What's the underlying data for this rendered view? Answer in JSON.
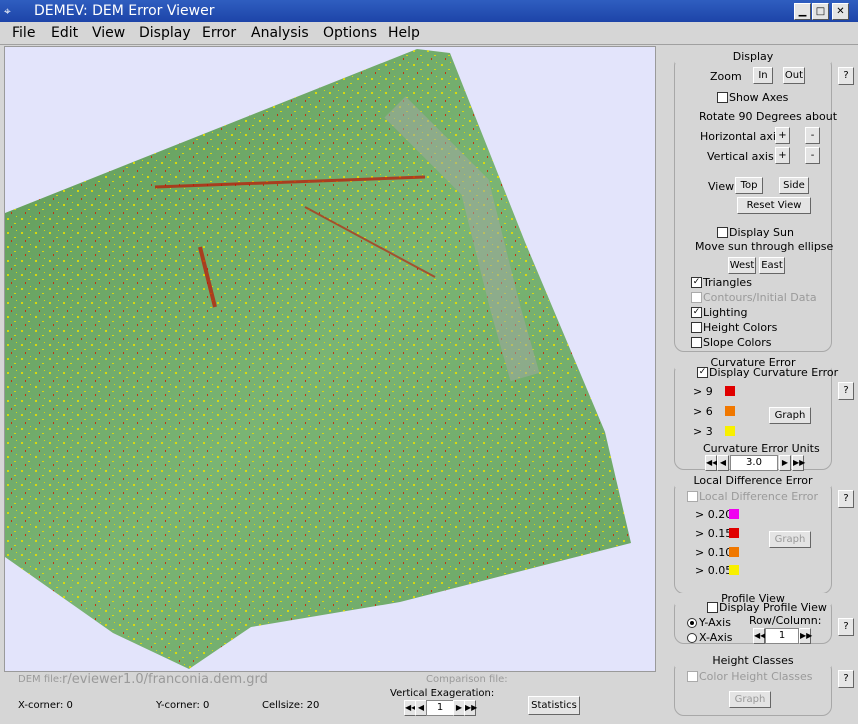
{
  "window": {
    "title": "DEMEV: DEM Error Viewer",
    "icon_label": "⌖"
  },
  "window_buttons": {
    "minimize": "▁",
    "maximize": "□",
    "close": "✕"
  },
  "menu": [
    "File",
    "Edit",
    "View",
    "Display",
    "Error",
    "Analysis",
    "Options",
    "Help"
  ],
  "display": {
    "title": "Display",
    "zoom_label": "Zoom",
    "zoom_in": "In",
    "zoom_out": "Out",
    "show_axes": "Show Axes",
    "rotate_label": "Rotate 90 Degrees about",
    "horizontal_axis": "Horizontal axis",
    "vertical_axis": "Vertical axis",
    "plus": "+",
    "minus": "-",
    "view_label": "View",
    "view_top": "Top",
    "view_side": "Side",
    "reset_view": "Reset View",
    "display_sun": "Display Sun",
    "move_sun": "Move sun through ellipse",
    "west": "West",
    "east": "East",
    "triangles": "Triangles",
    "contours": "Contours/Initial Data",
    "lighting": "Lighting",
    "height_colors": "Height Colors",
    "slope_colors": "Slope Colors",
    "help": "?"
  },
  "curvature": {
    "title": "Curvature Error",
    "display_curvature": "Display Curvature Error",
    "levels": [
      {
        "label": "> 9",
        "color": "#e00000"
      },
      {
        "label": "> 6",
        "color": "#f07800"
      },
      {
        "label": "> 3",
        "color": "#f8f000"
      }
    ],
    "graph": "Graph",
    "units_label": "Curvature Error Units",
    "units_value": "3.0",
    "help": "?"
  },
  "local_diff": {
    "title": "Local Difference Error",
    "checkbox": "Local Difference Error",
    "levels": [
      {
        "label": "> 0.20",
        "color": "#f000f0"
      },
      {
        "label": "> 0.15",
        "color": "#e00000"
      },
      {
        "label": "> 0.10",
        "color": "#f07800"
      },
      {
        "label": "> 0.05",
        "color": "#f8f000"
      }
    ],
    "graph": "Graph",
    "help": "?"
  },
  "profile": {
    "title": "Profile View",
    "display_profile": "Display Profile View",
    "y_axis": "Y-Axis",
    "x_axis": "X-Axis",
    "row_col_label": "Row/Column:",
    "row_col_value": "1",
    "help": "?"
  },
  "height_classes": {
    "title": "Height Classes",
    "color_height": "Color Height Classes",
    "graph": "Graph",
    "help": "?"
  },
  "status": {
    "dem_file_label": "DEM file:",
    "dem_file_value": "r/eviewer1.0/franconia.dem.grd",
    "comparison_label": "Comparison file:",
    "x_corner": "X-corner: 0",
    "y_corner": "Y-corner: 0",
    "cellsize": "Cellsize: 20",
    "vert_exag_label": "Vertical Exageration:",
    "vert_exag_value": "1",
    "statistics": "Statistics"
  },
  "colors": {
    "terrain": "#6fa86b",
    "background": "#e3e4fb",
    "title_bar": "#2450b4"
  }
}
